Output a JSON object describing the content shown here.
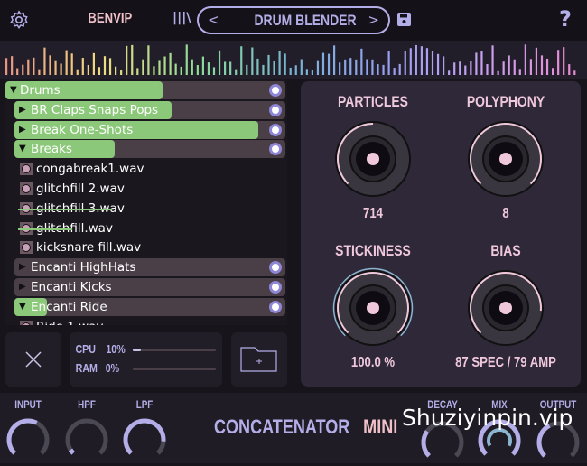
{
  "header": {
    "brand": "BENVIP",
    "preset": "DRUM BLENDER",
    "prev": "<",
    "next": ">",
    "help": "?",
    "library_icon": "|||\\"
  },
  "browser": {
    "rows": [
      {
        "type": "folder",
        "label": "Drums",
        "expanded": true,
        "indent": 0,
        "highlight": 0.56
      },
      {
        "type": "folder",
        "label": "BR Claps Snaps Pops",
        "expanded": false,
        "indent": 1,
        "highlight": 0.58
      },
      {
        "type": "folder",
        "label": "Break One-Shots",
        "expanded": false,
        "indent": 1,
        "highlight": 0.9
      },
      {
        "type": "folder",
        "label": "Breaks",
        "expanded": true,
        "indent": 1,
        "highlight": 0.37
      },
      {
        "type": "file",
        "label": "congabreak1.wav"
      },
      {
        "type": "file",
        "label": "glitchfill 2.wav"
      },
      {
        "type": "file",
        "label": "glitchfill 3.wav"
      },
      {
        "type": "file",
        "label": "glitchfill.wav"
      },
      {
        "type": "file",
        "label": "kicksnare fill.wav"
      },
      {
        "type": "folder",
        "label": "Encanti HighHats",
        "expanded": false,
        "indent": 1,
        "highlight": 0
      },
      {
        "type": "folder",
        "label": "Encanti Kicks",
        "expanded": false,
        "indent": 1,
        "highlight": 0
      },
      {
        "type": "folder",
        "label": "Encanti Ride",
        "expanded": true,
        "indent": 1,
        "highlight": 0.12
      },
      {
        "type": "file",
        "label": "Ride 1.wav"
      }
    ]
  },
  "stats": {
    "cpu_label": "CPU",
    "cpu_value": "10%",
    "cpu_fraction": 0.1,
    "ram_label": "RAM",
    "ram_value": "0%",
    "ram_fraction": 0
  },
  "knobs": [
    {
      "label": "PARTICLES",
      "value": "714",
      "fraction": 0.5
    },
    {
      "label": "POLYPHONY",
      "value": "8",
      "fraction": 1.0
    },
    {
      "label": "STICKINESS",
      "value": "100.0 %",
      "fraction": 1.0
    },
    {
      "label": "BIAS",
      "value": "87 SPEC / 79 AMP",
      "fraction": 0.85
    }
  ],
  "footer": {
    "title": "CONCATENATOR",
    "title_accent": "MINI",
    "knobs": [
      {
        "label": "INPUT",
        "fraction": 0.6
      },
      {
        "label": "HPF",
        "fraction": 0.05
      },
      {
        "label": "LPF",
        "fraction": 0.85
      },
      {
        "label": "DECAY",
        "fraction": 0.3
      },
      {
        "label": "MIX",
        "fraction": 1.0
      },
      {
        "label": "OUTPUT",
        "fraction": 0.4
      }
    ]
  },
  "watermark": "Shuziyinpin.vip",
  "colors": {
    "accent": "#b4aee8",
    "pink": "#f0c8dc",
    "green": "#8cc87a",
    "panel": "#2e2838"
  }
}
